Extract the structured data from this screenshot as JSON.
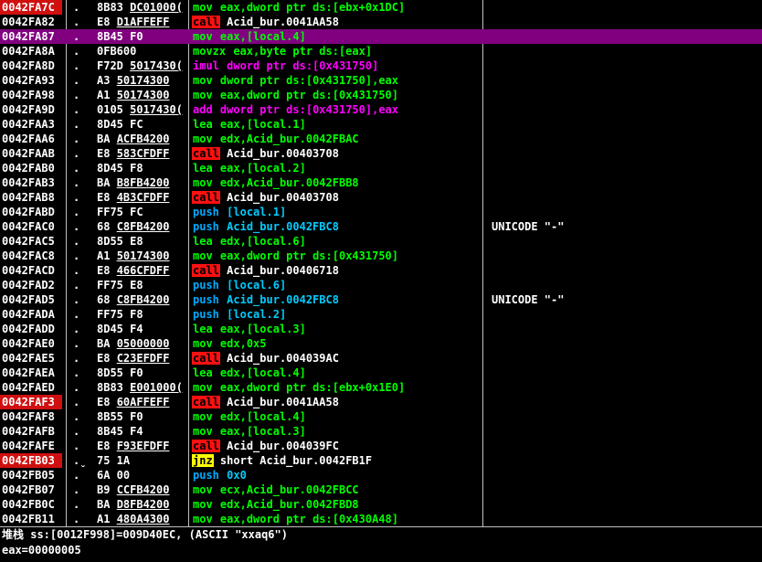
{
  "colors": {
    "address_highlight": "#d01010",
    "selected_row": "#800080",
    "call": "#ff1010",
    "jnz": "#ffff00",
    "move": "#00ff00",
    "arith": "#ff00ff",
    "push": "#00aaff"
  },
  "rows": [
    {
      "addr": "0042FA7C",
      "mark": ".",
      "hex": "8B83 DC01000(",
      "op": "mov",
      "args": "eax,dword ptr ds:[ebx+0x1DC]",
      "comment": "",
      "hl": true
    },
    {
      "addr": "0042FA82",
      "mark": ".",
      "hex": "E8 D1AFFEFF",
      "op": "call",
      "args": "Acid_bur.0041AA58",
      "comment": ""
    },
    {
      "addr": "0042FA87",
      "mark": ".",
      "hex": "8B45 F0",
      "op": "mov",
      "args": "eax,[local.4]",
      "comment": "",
      "sel": true
    },
    {
      "addr": "0042FA8A",
      "mark": ".",
      "hex": "0FB600",
      "op": "movzx",
      "args": "eax,byte ptr ds:[eax]",
      "comment": ""
    },
    {
      "addr": "0042FA8D",
      "mark": ".",
      "hex": "F72D 5017430(",
      "op": "imul",
      "args": "dword ptr ds:[0x431750]",
      "comment": ""
    },
    {
      "addr": "0042FA93",
      "mark": ".",
      "hex": "A3 50174300",
      "op": "mov",
      "args": "dword ptr ds:[0x431750],eax",
      "comment": ""
    },
    {
      "addr": "0042FA98",
      "mark": ".",
      "hex": "A1 50174300",
      "op": "mov",
      "args": "eax,dword ptr ds:[0x431750]",
      "comment": ""
    },
    {
      "addr": "0042FA9D",
      "mark": ".",
      "hex": "0105 5017430(",
      "op": "add",
      "args": "dword ptr ds:[0x431750],eax",
      "comment": ""
    },
    {
      "addr": "0042FAA3",
      "mark": ".",
      "hex": "8D45 FC",
      "op": "lea",
      "args": "eax,[local.1]",
      "comment": ""
    },
    {
      "addr": "0042FAA6",
      "mark": ".",
      "hex": "BA ACFB4200",
      "op": "mov",
      "args": "edx,Acid_bur.0042FBAC",
      "comment": ""
    },
    {
      "addr": "0042FAAB",
      "mark": ".",
      "hex": "E8 583CFDFF",
      "op": "call",
      "args": "Acid_bur.00403708",
      "comment": ""
    },
    {
      "addr": "0042FAB0",
      "mark": ".",
      "hex": "8D45 F8",
      "op": "lea",
      "args": "eax,[local.2]",
      "comment": ""
    },
    {
      "addr": "0042FAB3",
      "mark": ".",
      "hex": "BA B8FB4200",
      "op": "mov",
      "args": "edx,Acid_bur.0042FBB8",
      "comment": ""
    },
    {
      "addr": "0042FAB8",
      "mark": ".",
      "hex": "E8 4B3CFDFF",
      "op": "call",
      "args": "Acid_bur.00403708",
      "comment": ""
    },
    {
      "addr": "0042FABD",
      "mark": ".",
      "hex": "FF75 FC",
      "op": "push",
      "args": "[local.1]",
      "comment": ""
    },
    {
      "addr": "0042FAC0",
      "mark": ".",
      "hex": "68 C8FB4200",
      "op": "push",
      "args": "Acid_bur.0042FBC8",
      "comment": "UNICODE \"-\""
    },
    {
      "addr": "0042FAC5",
      "mark": ".",
      "hex": "8D55 E8",
      "op": "lea",
      "args": "edx,[local.6]",
      "comment": ""
    },
    {
      "addr": "0042FAC8",
      "mark": ".",
      "hex": "A1 50174300",
      "op": "mov",
      "args": "eax,dword ptr ds:[0x431750]",
      "comment": ""
    },
    {
      "addr": "0042FACD",
      "mark": ".",
      "hex": "E8 466CFDFF",
      "op": "call",
      "args": "Acid_bur.00406718",
      "comment": ""
    },
    {
      "addr": "0042FAD2",
      "mark": ".",
      "hex": "FF75 E8",
      "op": "push",
      "args": "[local.6]",
      "comment": ""
    },
    {
      "addr": "0042FAD5",
      "mark": ".",
      "hex": "68 C8FB4200",
      "op": "push",
      "args": "Acid_bur.0042FBC8",
      "comment": "UNICODE \"-\""
    },
    {
      "addr": "0042FADA",
      "mark": ".",
      "hex": "FF75 F8",
      "op": "push",
      "args": "[local.2]",
      "comment": ""
    },
    {
      "addr": "0042FADD",
      "mark": ".",
      "hex": "8D45 F4",
      "op": "lea",
      "args": "eax,[local.3]",
      "comment": ""
    },
    {
      "addr": "0042FAE0",
      "mark": ".",
      "hex": "BA 05000000",
      "op": "mov",
      "args": "edx,0x5",
      "comment": ""
    },
    {
      "addr": "0042FAE5",
      "mark": ".",
      "hex": "E8 C23EFDFF",
      "op": "call",
      "args": "Acid_bur.004039AC",
      "comment": ""
    },
    {
      "addr": "0042FAEA",
      "mark": ".",
      "hex": "8D55 F0",
      "op": "lea",
      "args": "edx,[local.4]",
      "comment": ""
    },
    {
      "addr": "0042FAED",
      "mark": ".",
      "hex": "8B83 E001000(",
      "op": "mov",
      "args": "eax,dword ptr ds:[ebx+0x1E0]",
      "comment": ""
    },
    {
      "addr": "0042FAF3",
      "mark": ".",
      "hex": "E8 60AFFEFF",
      "op": "call",
      "args": "Acid_bur.0041AA58",
      "comment": "",
      "hl": true
    },
    {
      "addr": "0042FAF8",
      "mark": ".",
      "hex": "8B55 F0",
      "op": "mov",
      "args": "edx,[local.4]",
      "comment": ""
    },
    {
      "addr": "0042FAFB",
      "mark": ".",
      "hex": "8B45 F4",
      "op": "mov",
      "args": "eax,[local.3]",
      "comment": ""
    },
    {
      "addr": "0042FAFE",
      "mark": ".",
      "hex": "E8 F93EFDFF",
      "op": "call",
      "args": "Acid_bur.004039FC",
      "comment": ""
    },
    {
      "addr": "0042FB03",
      "mark": ".ˬ",
      "hex": "75 1A",
      "op": "jnz",
      "args": "short Acid_bur.0042FB1F",
      "comment": "",
      "hl": true
    },
    {
      "addr": "0042FB05",
      "mark": ".",
      "hex": "6A 00",
      "op": "push",
      "args": "0x0",
      "comment": ""
    },
    {
      "addr": "0042FB07",
      "mark": ".",
      "hex": "B9 CCFB4200",
      "op": "mov",
      "args": "ecx,Acid_bur.0042FBCC",
      "comment": ""
    },
    {
      "addr": "0042FB0C",
      "mark": ".",
      "hex": "BA D8FB4200",
      "op": "mov",
      "args": "edx,Acid_bur.0042FBD8",
      "comment": ""
    },
    {
      "addr": "0042FB11",
      "mark": ".",
      "hex": "A1 480A4300",
      "op": "mov",
      "args": "eax,dword ptr ds:[0x430A48]",
      "comment": ""
    }
  ],
  "info": {
    "line1": "堆栈 ss:[0012F998]=009D40EC, (ASCII \"xxaq6\")",
    "line2": "eax=00000005"
  }
}
